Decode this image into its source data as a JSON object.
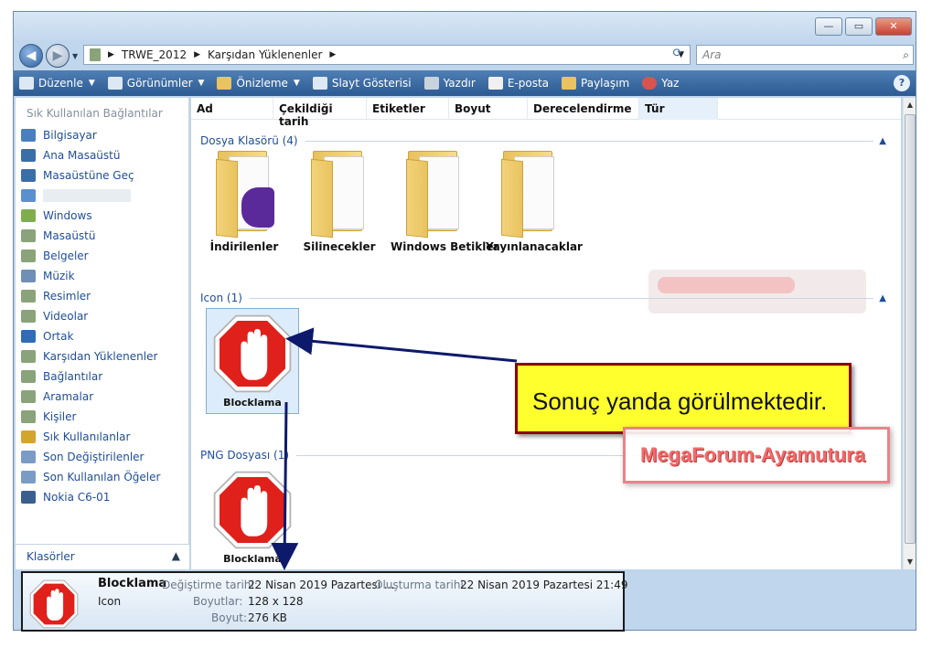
{
  "titlebar": {
    "minimize": "—",
    "maximize": "▭",
    "close": "✕"
  },
  "address": {
    "back": "◀",
    "forward": "▶",
    "crumbs": [
      "TRWE_2012",
      "Karşıdan Yüklenenler"
    ],
    "separator": "▶",
    "search_placeholder": "Ara"
  },
  "commands": [
    {
      "label": "Düzenle",
      "icon": "organize-icon",
      "dropdown": true
    },
    {
      "label": "Görünümler",
      "icon": "views-icon",
      "dropdown": true
    },
    {
      "label": "Önizleme",
      "icon": "preview-icon",
      "dropdown": true
    },
    {
      "label": "Slayt Gösterisi",
      "icon": "slideshow-icon",
      "dropdown": false
    },
    {
      "label": "Yazdır",
      "icon": "print-icon",
      "dropdown": false
    },
    {
      "label": "E-posta",
      "icon": "email-icon",
      "dropdown": false
    },
    {
      "label": "Paylaşım",
      "icon": "share-icon",
      "dropdown": false
    },
    {
      "label": "Yaz",
      "icon": "burn-icon",
      "dropdown": false
    }
  ],
  "help": "?",
  "nav": {
    "title": "Sık Kullanılan Bağlantılar",
    "items": [
      {
        "label": "Bilgisayar",
        "color": "#4a7fbf"
      },
      {
        "label": "Ana Masaüstü",
        "color": "#3a6ea8"
      },
      {
        "label": "Masaüstüne Geç",
        "color": "#3a6ea8"
      },
      {
        "label": "",
        "color": "#5b8fd0"
      },
      {
        "label": "Windows",
        "color": "#7fae4c"
      },
      {
        "label": "Masaüstü",
        "color": "#8aa37a"
      },
      {
        "label": "Belgeler",
        "color": "#8aa37a"
      },
      {
        "label": "Müzik",
        "color": "#6f8fb5"
      },
      {
        "label": "Resimler",
        "color": "#8aa37a"
      },
      {
        "label": "Videolar",
        "color": "#8aa37a"
      },
      {
        "label": "Ortak",
        "color": "#2f6db5"
      },
      {
        "label": "Karşıdan Yüklenenler",
        "color": "#8aa37a"
      },
      {
        "label": "Bağlantılar",
        "color": "#8aa37a"
      },
      {
        "label": "Aramalar",
        "color": "#8aa37a"
      },
      {
        "label": "Kişiler",
        "color": "#8aa37a"
      },
      {
        "label": "Sık Kullanılanlar",
        "color": "#d4a52c"
      },
      {
        "label": "Son Değiştirilenler",
        "color": "#7a9cc4"
      },
      {
        "label": "Son Kullanılan Öğeler",
        "color": "#7a9cc4"
      },
      {
        "label": "Nokia C6-01",
        "color": "#3a5f8f"
      }
    ],
    "folders_label": "Klasörler"
  },
  "columns": [
    "Ad",
    "Çekildiği tarih",
    "Etiketler",
    "Boyut",
    "Derecelendirme",
    "Tür"
  ],
  "groups": {
    "folders": {
      "header": "Dosya Klasörü (4)",
      "items": [
        "İndirilenler",
        "Silinecekler",
        "Windows Betikler",
        "Yayınlanacaklar"
      ]
    },
    "icon": {
      "header": "Icon (1)",
      "item": "Blocklama"
    },
    "png": {
      "header": "PNG Dosyası (1)",
      "item": "Blocklama"
    }
  },
  "details": {
    "name": "Blocklama",
    "type": "Icon",
    "modified_key": "Değiştirme tarihi:",
    "modified_val": "22 Nisan 2019 Pazartesi ...",
    "created_key": "Oluşturma tarihi:",
    "created_val": "22 Nisan 2019 Pazartesi 21:49",
    "dims_key": "Boyutlar:",
    "dims_val": "128 x 128",
    "size_key": "Boyut:",
    "size_val": "276 KB"
  },
  "annotation": {
    "callout": "Sonuç yanda görülmektedir.",
    "watermark": "MegaForum-Ayamutura"
  },
  "colors": {
    "accent": "#2c5a92",
    "stop_red": "#e0201b",
    "callout_bg": "#ffff2e",
    "arrow": "#0d1a6b"
  }
}
